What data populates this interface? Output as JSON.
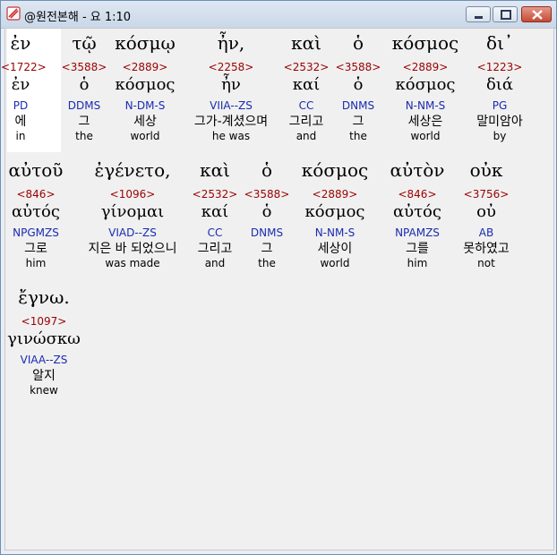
{
  "window": {
    "title": "@원전본해 - 요 1:10"
  },
  "rows": [
    [
      {
        "greek": "ἐν",
        "num": "<1722>",
        "lemma": "ἐν",
        "parse": "PD",
        "kor": "에",
        "eng": "in"
      },
      {
        "greek": "τῷ",
        "num": "<3588>",
        "lemma": "ὁ",
        "parse": "DDMS",
        "kor": "그",
        "eng": "the"
      },
      {
        "greek": "κόσμῳ",
        "num": "<2889>",
        "lemma": "κόσμος",
        "parse": "N-DM-S",
        "kor": "세상",
        "eng": "world"
      },
      {
        "greek": "ἦν,",
        "num": "<2258>",
        "lemma": "ἦν",
        "parse": "VIIA--ZS",
        "kor": "그가-계셨으며",
        "eng": "he was"
      },
      {
        "greek": "καὶ",
        "num": "<2532>",
        "lemma": "καί",
        "parse": "CC",
        "kor": "그리고",
        "eng": "and"
      },
      {
        "greek": "ὁ",
        "num": "<3588>",
        "lemma": "ὁ",
        "parse": "DNMS",
        "kor": "그",
        "eng": "the"
      },
      {
        "greek": "κόσμος",
        "num": "<2889>",
        "lemma": "κόσμος",
        "parse": "N-NM-S",
        "kor": "세상은",
        "eng": "world"
      },
      {
        "greek": "δι᾽",
        "num": "<1223>",
        "lemma": "διά",
        "parse": "PG",
        "kor": "말미암아",
        "eng": "by"
      }
    ],
    [
      {
        "greek": "αὐτοῦ",
        "num": "<846>",
        "lemma": "αὐτός",
        "parse": "NPGMZS",
        "kor": "그로",
        "eng": "him"
      },
      {
        "greek": "ἐγένετο,",
        "num": "<1096>",
        "lemma": "γίνομαι",
        "parse": "VIAD--ZS",
        "kor": "지은 바 되었으니",
        "eng": "was made"
      },
      {
        "greek": "καὶ",
        "num": "<2532>",
        "lemma": "καί",
        "parse": "CC",
        "kor": "그리고",
        "eng": "and"
      },
      {
        "greek": "ὁ",
        "num": "<3588>",
        "lemma": "ὁ",
        "parse": "DNMS",
        "kor": "그",
        "eng": "the"
      },
      {
        "greek": "κόσμος",
        "num": "<2889>",
        "lemma": "κόσμος",
        "parse": "N-NM-S",
        "kor": "세상이",
        "eng": "world"
      },
      {
        "greek": "αὐτὸν",
        "num": "<846>",
        "lemma": "αὐτός",
        "parse": "NPAMZS",
        "kor": "그를",
        "eng": "him"
      },
      {
        "greek": "οὐκ",
        "num": "<3756>",
        "lemma": "οὐ",
        "parse": "AB",
        "kor": "못하였고",
        "eng": "not"
      }
    ],
    [
      {
        "greek": "ἔγνω.",
        "num": "<1097>",
        "lemma": "γινώσκω",
        "parse": "VIAA--ZS",
        "kor": "알지",
        "eng": "knew"
      }
    ]
  ]
}
